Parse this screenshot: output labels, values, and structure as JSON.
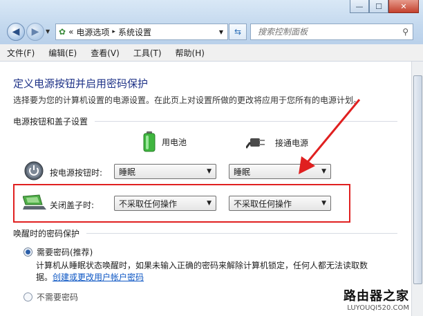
{
  "window": {
    "min": "—",
    "max": "☐",
    "close": "✕"
  },
  "addressbar": {
    "prefix": "«",
    "crumb1": "电源选项",
    "sep": "▸",
    "crumb2": "系统设置"
  },
  "search": {
    "placeholder": "搜索控制面板"
  },
  "menu": [
    "文件(F)",
    "编辑(E)",
    "查看(V)",
    "工具(T)",
    "帮助(H)"
  ],
  "page": {
    "title": "定义电源按钮并启用密码保护",
    "description": "选择要为您的计算机设置的电源设置。在此页上对设置所做的更改将应用于您所有的电源计划。"
  },
  "power_section": {
    "header": "电源按钮和盖子设置",
    "col_battery": "用电池",
    "col_plugged": "接通电源",
    "rows": [
      {
        "label": "按电源按钮时:",
        "battery": "睡眠",
        "plugged": "睡眠"
      },
      {
        "label": "关闭盖子时:",
        "battery": "不采取任何操作",
        "plugged": "不采取任何操作"
      }
    ]
  },
  "wake_section": {
    "header": "唤醒时的密码保护",
    "option1": "需要密码(推荐)",
    "option1_desc1": "计算机从睡眠状态唤醒时，如果未输入正确的密码来解除计算机锁定，任何人都无法读取数",
    "option1_desc2_prefix": "据。",
    "option1_link": "创建或更改用户帐户密码",
    "option2": "不需要密码"
  },
  "watermark": {
    "line1": "路由器之家",
    "line2": "LUYOUQI520.COM"
  }
}
